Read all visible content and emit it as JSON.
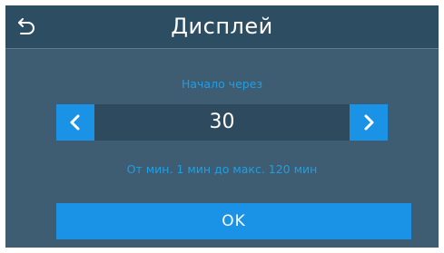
{
  "header": {
    "title": "Дисплей",
    "back_icon": "undo-arrow-icon"
  },
  "setting": {
    "label": "Начало через",
    "value": "30",
    "range_hint": "От мин. 1 мин до макс. 120 мин",
    "decrement_icon": "chevron-left-icon",
    "increment_icon": "chevron-right-icon"
  },
  "actions": {
    "ok_label": "OK"
  },
  "colors": {
    "background": "#3e5d72",
    "header": "#2d4d63",
    "accent": "#1a93e6",
    "hint_text": "#1e9fe6",
    "stepper_field": "#2e4a5e"
  }
}
